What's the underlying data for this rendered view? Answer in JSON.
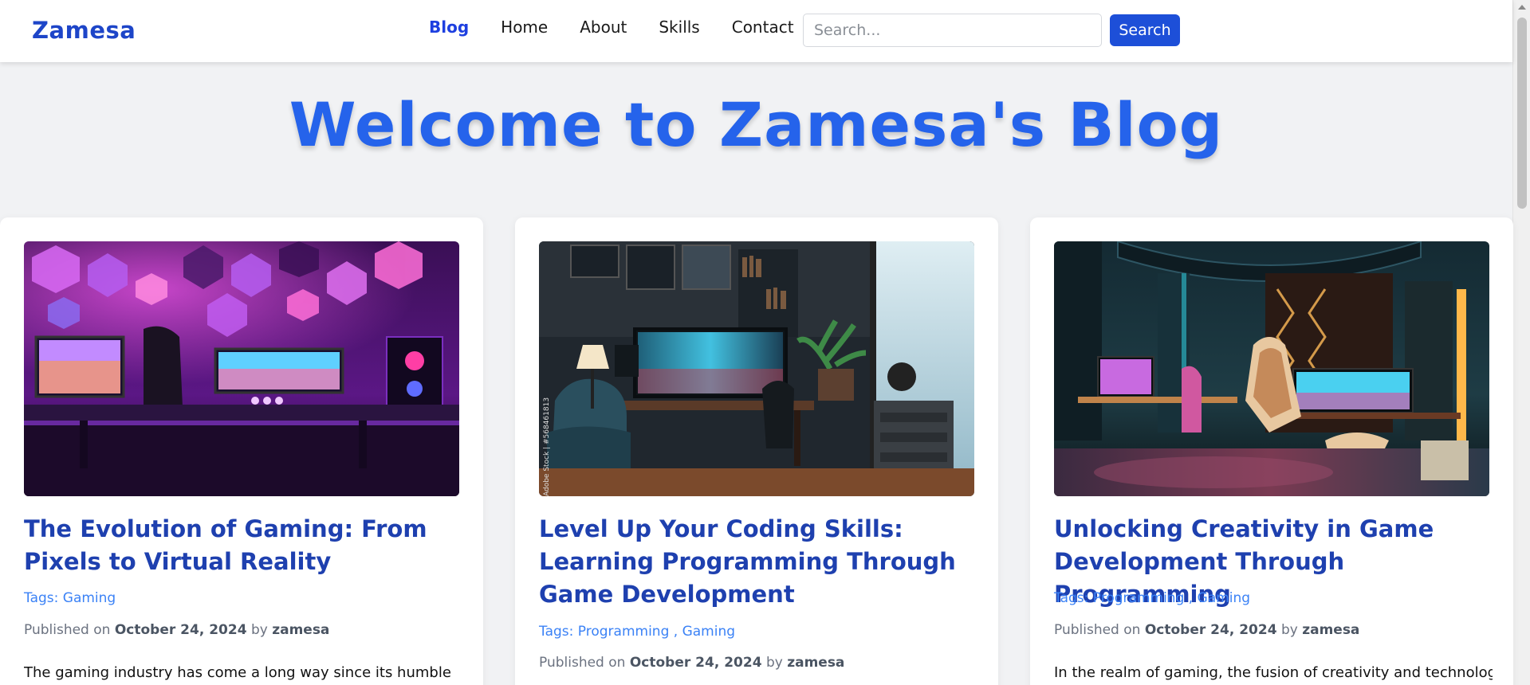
{
  "nav": {
    "brand": "Zamesa",
    "links": [
      "Blog",
      "Home",
      "About",
      "Skills",
      "Contact"
    ],
    "search_placeholder": "Search...",
    "search_button": "Search",
    "accent": "#1d4fd8"
  },
  "hero": {
    "title": "Welcome to Zamesa's Blog"
  },
  "posts": [
    {
      "title": "The Evolution of Gaming: From Pixels to Virtual Reality",
      "tags_label": "Tags:",
      "tags": [
        "Gaming"
      ],
      "published_label": "Published on",
      "date": "October 24, 2024",
      "by_label": "by",
      "author": "zamesa",
      "excerpt": "The gaming industry has come a long way since its humble",
      "image": "purple-neon-gaming-room"
    },
    {
      "title": "Level Up Your Coding Skills: Learning Programming Through Game Development",
      "tags_label": "Tags:",
      "tags": [
        "Programming",
        "Gaming"
      ],
      "published_label": "Published on",
      "date": "October 24, 2024",
      "by_label": "by",
      "author": "zamesa",
      "excerpt": "",
      "image": "teal-gaming-desk-setup",
      "watermark": "Adobe Stock | #568461813"
    },
    {
      "title": "Unlocking Creativity in Game Development Through Programming",
      "tags_label": "Tags:",
      "tags": [
        "Programming",
        "Gaming"
      ],
      "published_label": "Published on",
      "date": "October 24, 2024",
      "by_label": "by",
      "author": "zamesa",
      "excerpt": "In the realm of gaming, the fusion of creativity and technology",
      "image": "cyberpunk-gaming-lounge"
    }
  ]
}
